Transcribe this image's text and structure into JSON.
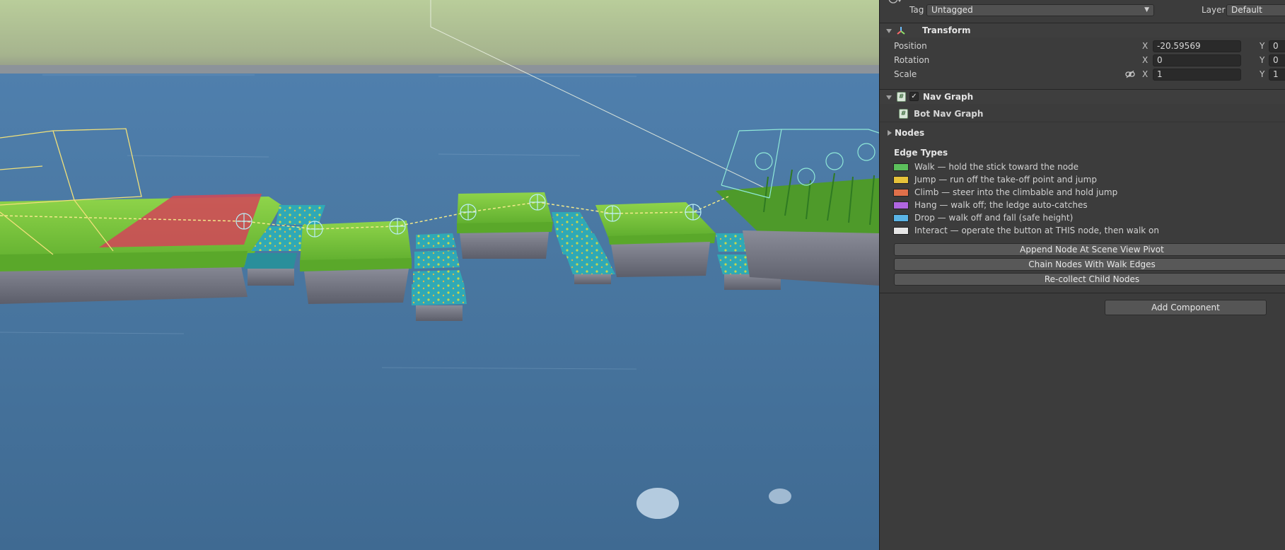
{
  "inspector": {
    "tag_label": "Tag",
    "tag_value": "Untagged",
    "layer_label": "Layer",
    "layer_value": "Default",
    "transform": {
      "title": "Transform",
      "position_label": "Position",
      "rotation_label": "Rotation",
      "scale_label": "Scale",
      "x_label": "X",
      "y_label": "Y",
      "position_x": "-20.59569",
      "position_y": "0",
      "rotation_x": "0",
      "rotation_y": "0",
      "scale_x": "1",
      "scale_y": "1"
    },
    "nav_graph": {
      "title": "Nav Graph",
      "enabled_check": "✓",
      "script_name": "Bot Nav Graph",
      "nodes_label": "Nodes",
      "edge_types_title": "Edge Types",
      "edge_types": [
        {
          "label": "Walk — hold the stick toward the node",
          "color": "#5cc05c"
        },
        {
          "label": "Jump — run off the take-off point and jump",
          "color": "#e6c23a"
        },
        {
          "label": "Climb — steer into the climbable and hold jump",
          "color": "#e0704a"
        },
        {
          "label": "Hang — walk off; the ledge auto-catches",
          "color": "#b066e0"
        },
        {
          "label": "Drop — walk off and fall (safe height)",
          "color": "#5ab4e6"
        },
        {
          "label": "Interact — operate the button at THIS node, then walk on",
          "color": "#e6e6e6"
        }
      ],
      "buttons": {
        "append": "Append Node At Scene View Pivot",
        "chain": "Chain Nodes With Walk Edges",
        "recollect": "Re-collect Child Nodes"
      }
    },
    "add_component": "Add Component"
  },
  "icons": {
    "foldout_open": "chevron-down-icon",
    "foldout_closed": "chevron-right-icon",
    "transform": "transform-axes-icon",
    "script": "script-icon",
    "constrain": "link-icon",
    "dropdown": "dropdown-caret-icon"
  }
}
